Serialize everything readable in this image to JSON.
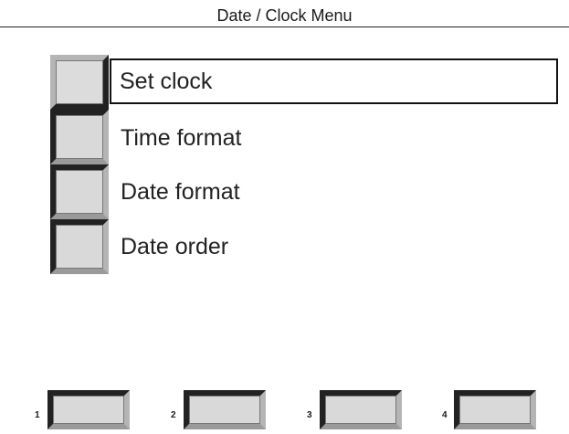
{
  "title": "Date / Clock Menu",
  "menu": {
    "items": [
      {
        "label": "Set clock",
        "selected": true
      },
      {
        "label": "Time format",
        "selected": false
      },
      {
        "label": "Date format",
        "selected": false
      },
      {
        "label": "Date order",
        "selected": false
      }
    ]
  },
  "softkeys": {
    "numbers": [
      "1",
      "2",
      "3",
      "4"
    ]
  }
}
